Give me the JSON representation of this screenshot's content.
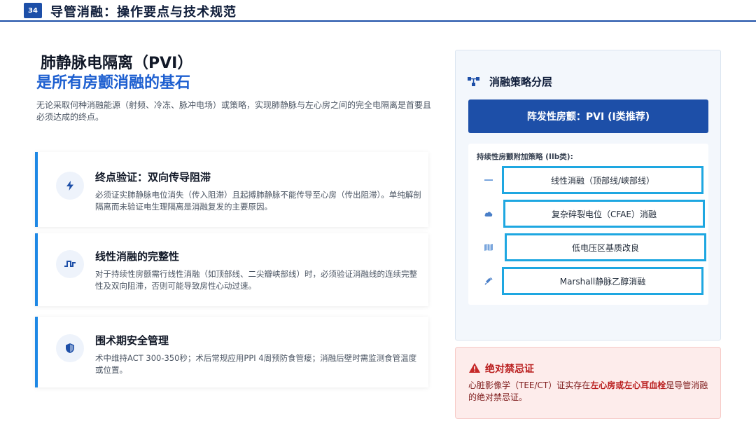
{
  "header": {
    "page_number": "34",
    "title": "导管消融：操作要点与技术规范"
  },
  "left": {
    "title_line1": "肺静脉电隔离（PVI）",
    "title_line2": "是所有房颤消融的基石",
    "intro": "无论采取何种消融能源（射频、冷冻、脉冲电场）或策略，实现肺静脉与左心房之间的完全电隔离是首要且必须达成的终点。",
    "cards": [
      {
        "icon": "lightning-icon",
        "title": "终点验证：双向传导阻滞",
        "desc": "必须证实肺静脉电位消失（传入阻滞）且起搏肺静脉不能传导至心房（传出阻滞）。单纯解剖隔离而未验证电生理隔离是消融复发的主要原因。"
      },
      {
        "icon": "pulse-wave-icon",
        "title": "线性消融的完整性",
        "desc": "对于持续性房颤需行线性消融（如顶部线、二尖瓣峡部线）时，必须验证消融线的连续完整性及双向阻滞，否则可能导致房性心动过速。"
      },
      {
        "icon": "shield-icon",
        "title": "围术期安全管理",
        "desc": "术中维持ACT 300-350秒；术后常规应用PPI 4周预防食管瘘；消融后壁时需监测食管温度或位置。"
      }
    ]
  },
  "panel": {
    "title": "消融策略分层",
    "title_icon": "hierarchy-icon",
    "primary": "阵发性房颤：PVI (I类推荐)",
    "sub_label": "持续性房颤附加策略 (IIb类):",
    "strategies": [
      {
        "icon": "minus-icon",
        "label": "线性消融（顶部线/峡部线）"
      },
      {
        "icon": "cloud-icon",
        "label": "复杂碎裂电位（CFAE）消融"
      },
      {
        "icon": "map-icon",
        "label": "低电压区基质改良"
      },
      {
        "icon": "syringe-icon",
        "label": "Marshall静脉乙醇消融"
      }
    ]
  },
  "warning": {
    "icon": "warning-triangle-icon",
    "title": "绝对禁忌证",
    "text_before": "心脏影像学（TEE/CT）证实存在",
    "text_bold": "左心房或左心耳血栓",
    "text_after": "是导管消融的绝对禁忌证。"
  },
  "colors": {
    "brand": "#1d4fa8",
    "accent": "#1d5fd0",
    "card_border": "#1e88e5",
    "strategy_border": "#1ea7e1",
    "warning": "#b91c1c"
  }
}
